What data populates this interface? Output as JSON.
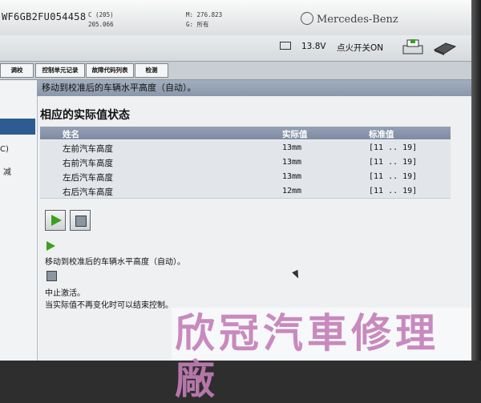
{
  "header": {
    "vin_fragment": "WF6GB2FU054458",
    "code_top": "C (205)",
    "code_bottom": "205.066",
    "m_line": "M: 276.823",
    "g_line": "G: 所有",
    "brand": "Mercedes-Benz"
  },
  "status": {
    "voltage": "13.8V",
    "ignition": "点火开关ON"
  },
  "toolbar": {
    "tabs": [
      "调校",
      "控制单元记录",
      "故障代码列表",
      "检测"
    ]
  },
  "title": "移动到校准后的车辆水平高度（自动）。",
  "left_pane": {
    "frag_1": "C)",
    "frag_2": "减"
  },
  "section_title": "相应的实际值状态",
  "table": {
    "columns": [
      "姓名",
      "实际值",
      "标准值"
    ],
    "rows": [
      {
        "name": "左前汽车高度",
        "actual": "13mm",
        "standard": "[11 .. 19]"
      },
      {
        "name": "右前汽车高度",
        "actual": "13mm",
        "standard": "[11 .. 19]"
      },
      {
        "name": "左后汽车高度",
        "actual": "13mm",
        "standard": "[11 .. 19]"
      },
      {
        "name": "右后汽车高度",
        "actual": "12mm",
        "standard": "[11 .. 19]"
      }
    ]
  },
  "legend": {
    "play_desc": "移动到校准后的车辆水平高度（自动）。",
    "stop_desc_1": "中止激活。",
    "stop_desc_2": "当实际值不再变化时可以结束控制。"
  },
  "watermark": "欣冠汽車修理廠",
  "icons": [
    "battery-icon",
    "printer-icon",
    "toolbox-icon",
    "play-icon",
    "stop-icon",
    "mercedes-star-icon"
  ],
  "colors": {
    "title_band": "#8a97aa",
    "table_header": "#7e8aa0",
    "play_green": "#3aa01d",
    "selection_blue": "#2c5c92"
  }
}
